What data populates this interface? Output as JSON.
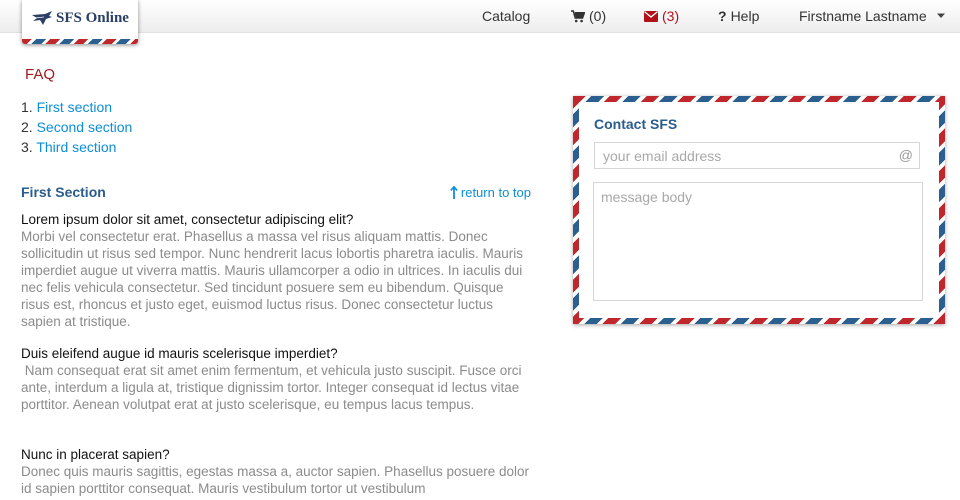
{
  "app": {
    "logo_text": "SFS Online"
  },
  "nav": {
    "catalog": "Catalog",
    "cart_count": "(0)",
    "messages_count": "(3)",
    "help": "Help",
    "user": "Firstname Lastname"
  },
  "faq": {
    "title": "FAQ",
    "toc": [
      {
        "num": "1.",
        "label": "First section"
      },
      {
        "num": "2.",
        "label": "Second section"
      },
      {
        "num": "3.",
        "label": "Third section"
      }
    ],
    "section": {
      "title": "First Section",
      "return_label": "return to top",
      "items": [
        {
          "question": "Lorem ipsum dolor sit amet, consectetur adipiscing elit?",
          "answer": "Morbi vel consectetur erat. Phasellus a massa vel risus aliquam mattis. Donec sollicitudin ut risus sed tempor. Nunc hendrerit lacus lobortis pharetra iaculis. Mauris imperdiet augue ut viverra mattis. Mauris ullamcorper a odio in ultrices. In iaculis dui nec felis vehicula consectetur. Sed tincidunt posuere sem eu bibendum. Quisque risus est, rhoncus et justo eget, euismod luctus risus. Donec consectetur luctus sapien at tristique."
        },
        {
          "question": "Duis eleifend augue id mauris scelerisque imperdiet?",
          "answer": " Nam consequat erat sit amet enim fermentum, et vehicula justo suscipit. Fusce orci ante, interdum a ligula at, tristique dignissim tortor. Integer consequat id lectus vitae porttitor. Aenean volutpat erat at justo scelerisque, eu tempus lacus tempus."
        },
        {
          "question": "Nunc in placerat sapien?",
          "answer": "Donec quis mauris sagittis, egestas massa a, auctor sapien. Phasellus posuere dolor id sapien porttitor consequat. Mauris vestibulum tortor ut vestibulum"
        }
      ]
    }
  },
  "contact": {
    "title": "Contact SFS",
    "email_placeholder": "your email address",
    "email_icon": "@",
    "message_placeholder": "message body"
  },
  "colors": {
    "link": "#0d8ed8",
    "heading_red": "#9b1b1b",
    "heading_blue": "#2a5d8c",
    "airmail_red": "#c0272d",
    "airmail_blue": "#2a5f8f",
    "alert": "#b3111a"
  },
  "icons": {
    "logo": "eagle-logo-icon",
    "cart": "shopping-cart-icon",
    "messages": "envelope-icon",
    "help": "question-mark-icon",
    "user_menu": "caret-down-icon",
    "return_top": "arrow-up-icon",
    "email": "at-sign-icon"
  }
}
